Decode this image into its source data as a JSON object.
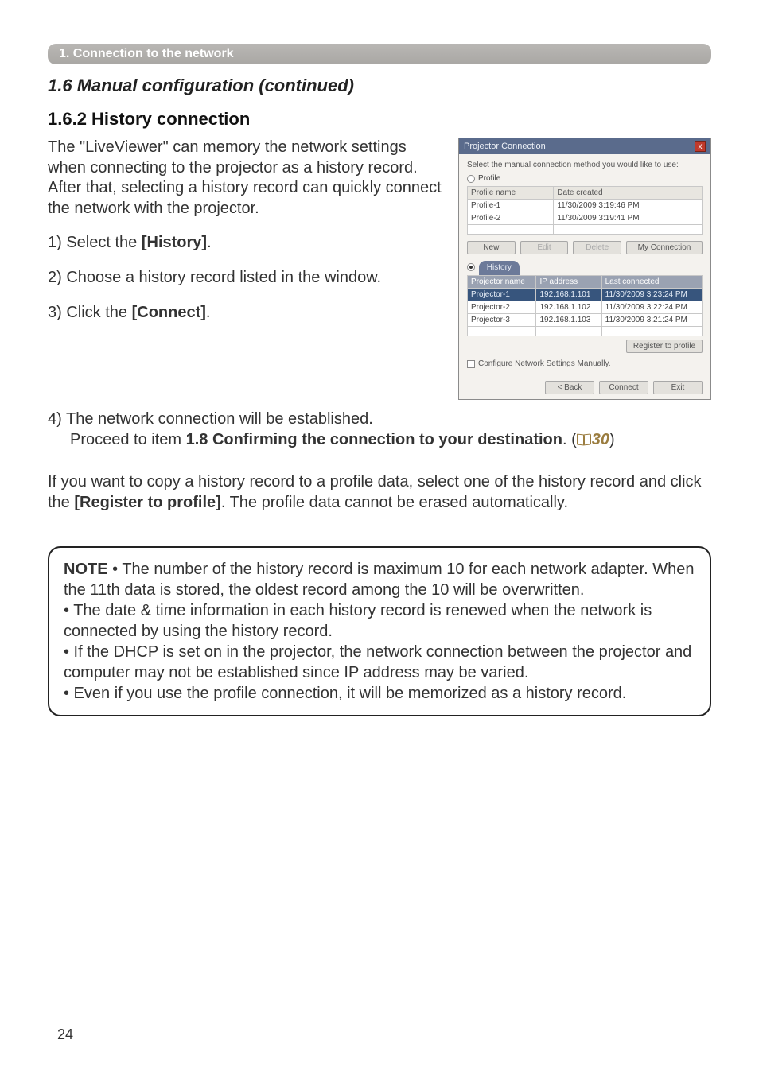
{
  "header": {
    "bar": "1. Connection to the network"
  },
  "section": {
    "title": "1.6 Manual configuration (continued)"
  },
  "subsection": {
    "title": "1.6.2 History connection"
  },
  "intro": {
    "text": "The \"LiveViewer\" can memory the network settings when connecting to the projector as a history record. After that, selecting a history record can quickly connect the network with the projector."
  },
  "steps": {
    "s1a": "1) Select the ",
    "s1b": "[History]",
    "s1c": ".",
    "s2": "2) Choose a history record listed in the window.",
    "s3a": "3) Click the ",
    "s3b": "[Connect]",
    "s3c": ".",
    "s4a": "4) The network connection will be established.",
    "s4b_pre": "Proceed to item ",
    "s4b_bold": "1.8 Confirming the connection to your destination",
    "s4b_post": ". (",
    "s4b_page": "30",
    "s4b_close": ")"
  },
  "copy_para_a": "If you want to copy a history record to a profile data, select one of the history record and click the ",
  "copy_para_b": "[Register to profile]",
  "copy_para_c": ". The profile data cannot be erased automatically.",
  "note": {
    "label": "NOTE",
    "l1": " • The number of the history record is maximum 10 for each network adapter. When the 11th data is stored, the oldest record among the 10 will be overwritten.",
    "l2": "• The date & time information in each history record is renewed when the network is connected by using the history record.",
    "l3": "• If the DHCP is set on in the projector, the network connection between the projector and computer may not be established since IP address may be varied.",
    "l4": "• Even if you use the profile connection, it will be memorized as a history record."
  },
  "page_number": "24",
  "dialog": {
    "title": "Projector Connection",
    "subtitle": "Select the manual connection method you would like to use:",
    "profile_radio": "Profile",
    "history_radio": "History",
    "profile_table": {
      "h1": "Profile name",
      "h2": "Date created",
      "rows": [
        {
          "name": "Profile-1",
          "date": "11/30/2009 3:19:46 PM"
        },
        {
          "name": "Profile-2",
          "date": "11/30/2009 3:19:41 PM"
        }
      ]
    },
    "buttons": {
      "new": "New",
      "edit": "Edit",
      "delete": "Delete",
      "myconn": "My Connection"
    },
    "history_table": {
      "h1": "Projector name",
      "h2": "IP address",
      "h3": "Last connected",
      "rows": [
        {
          "name": "Projector-1",
          "ip": "192.168.1.101",
          "last": "11/30/2009 3:23:24 PM",
          "sel": true
        },
        {
          "name": "Projector-2",
          "ip": "192.168.1.102",
          "last": "11/30/2009 3:22:24 PM"
        },
        {
          "name": "Projector-3",
          "ip": "192.168.1.103",
          "last": "11/30/2009 3:21:24 PM"
        }
      ]
    },
    "register": "Register to profile",
    "manual_chk": "Configure Network Settings Manually.",
    "footer": {
      "back": "< Back",
      "connect": "Connect",
      "exit": "Exit"
    }
  }
}
